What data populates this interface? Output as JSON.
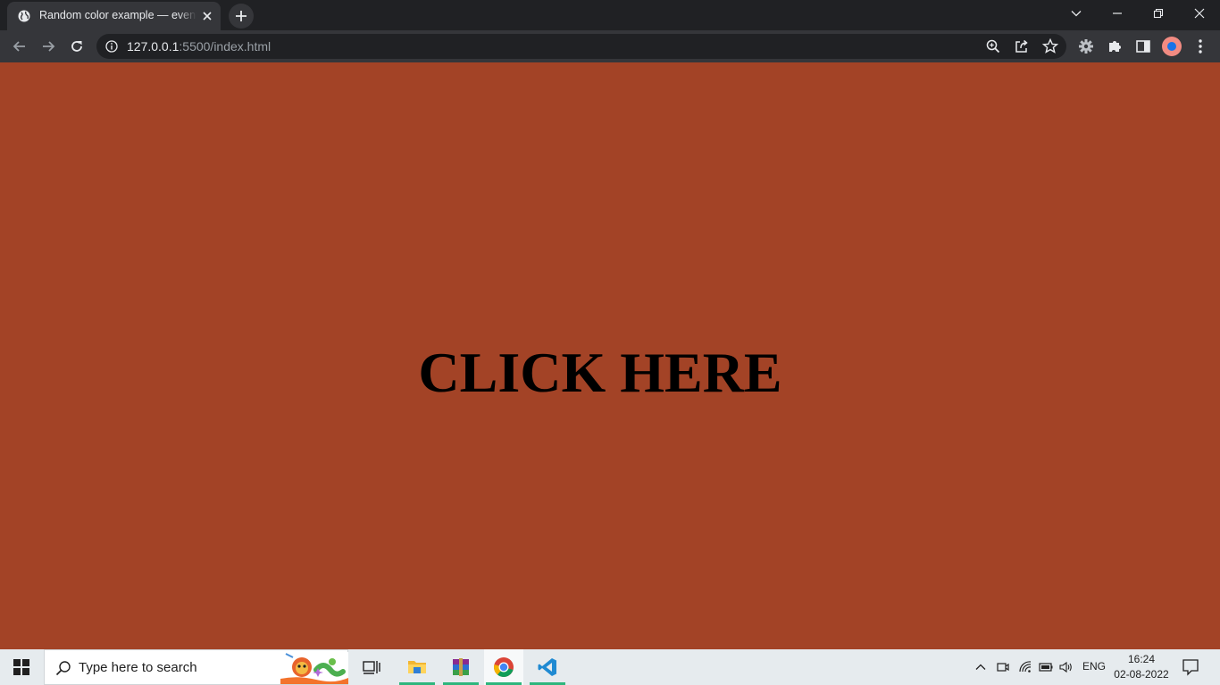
{
  "browser": {
    "tab_title": "Random color example — event listener",
    "url_host": "127.0.0.1",
    "url_rest": ":5500/index.html"
  },
  "page": {
    "heading": "CLICK HERE",
    "background_color": "#a34326"
  },
  "taskbar": {
    "search_placeholder": "Type here to search",
    "language": "ENG",
    "time": "16:24",
    "date": "02-08-2022"
  },
  "icons": {
    "tab_favicon": "globe-icon",
    "tab_close": "close-icon",
    "new_tab": "plus-icon",
    "back": "arrow-left-icon",
    "forward": "arrow-right-icon",
    "reload": "reload-icon",
    "site_info": "info-icon",
    "zoom": "zoom-icon",
    "share": "share-icon",
    "bookmark": "star-icon",
    "extensions": "puzzle-icon",
    "side_panel": "side-panel-icon",
    "menu": "kebab-menu-icon"
  },
  "colors": {
    "chrome_frame": "#202124",
    "chrome_toolbar": "#35363a",
    "taskbar": "#e6ebee",
    "running_indicator": "#2eb67d"
  }
}
